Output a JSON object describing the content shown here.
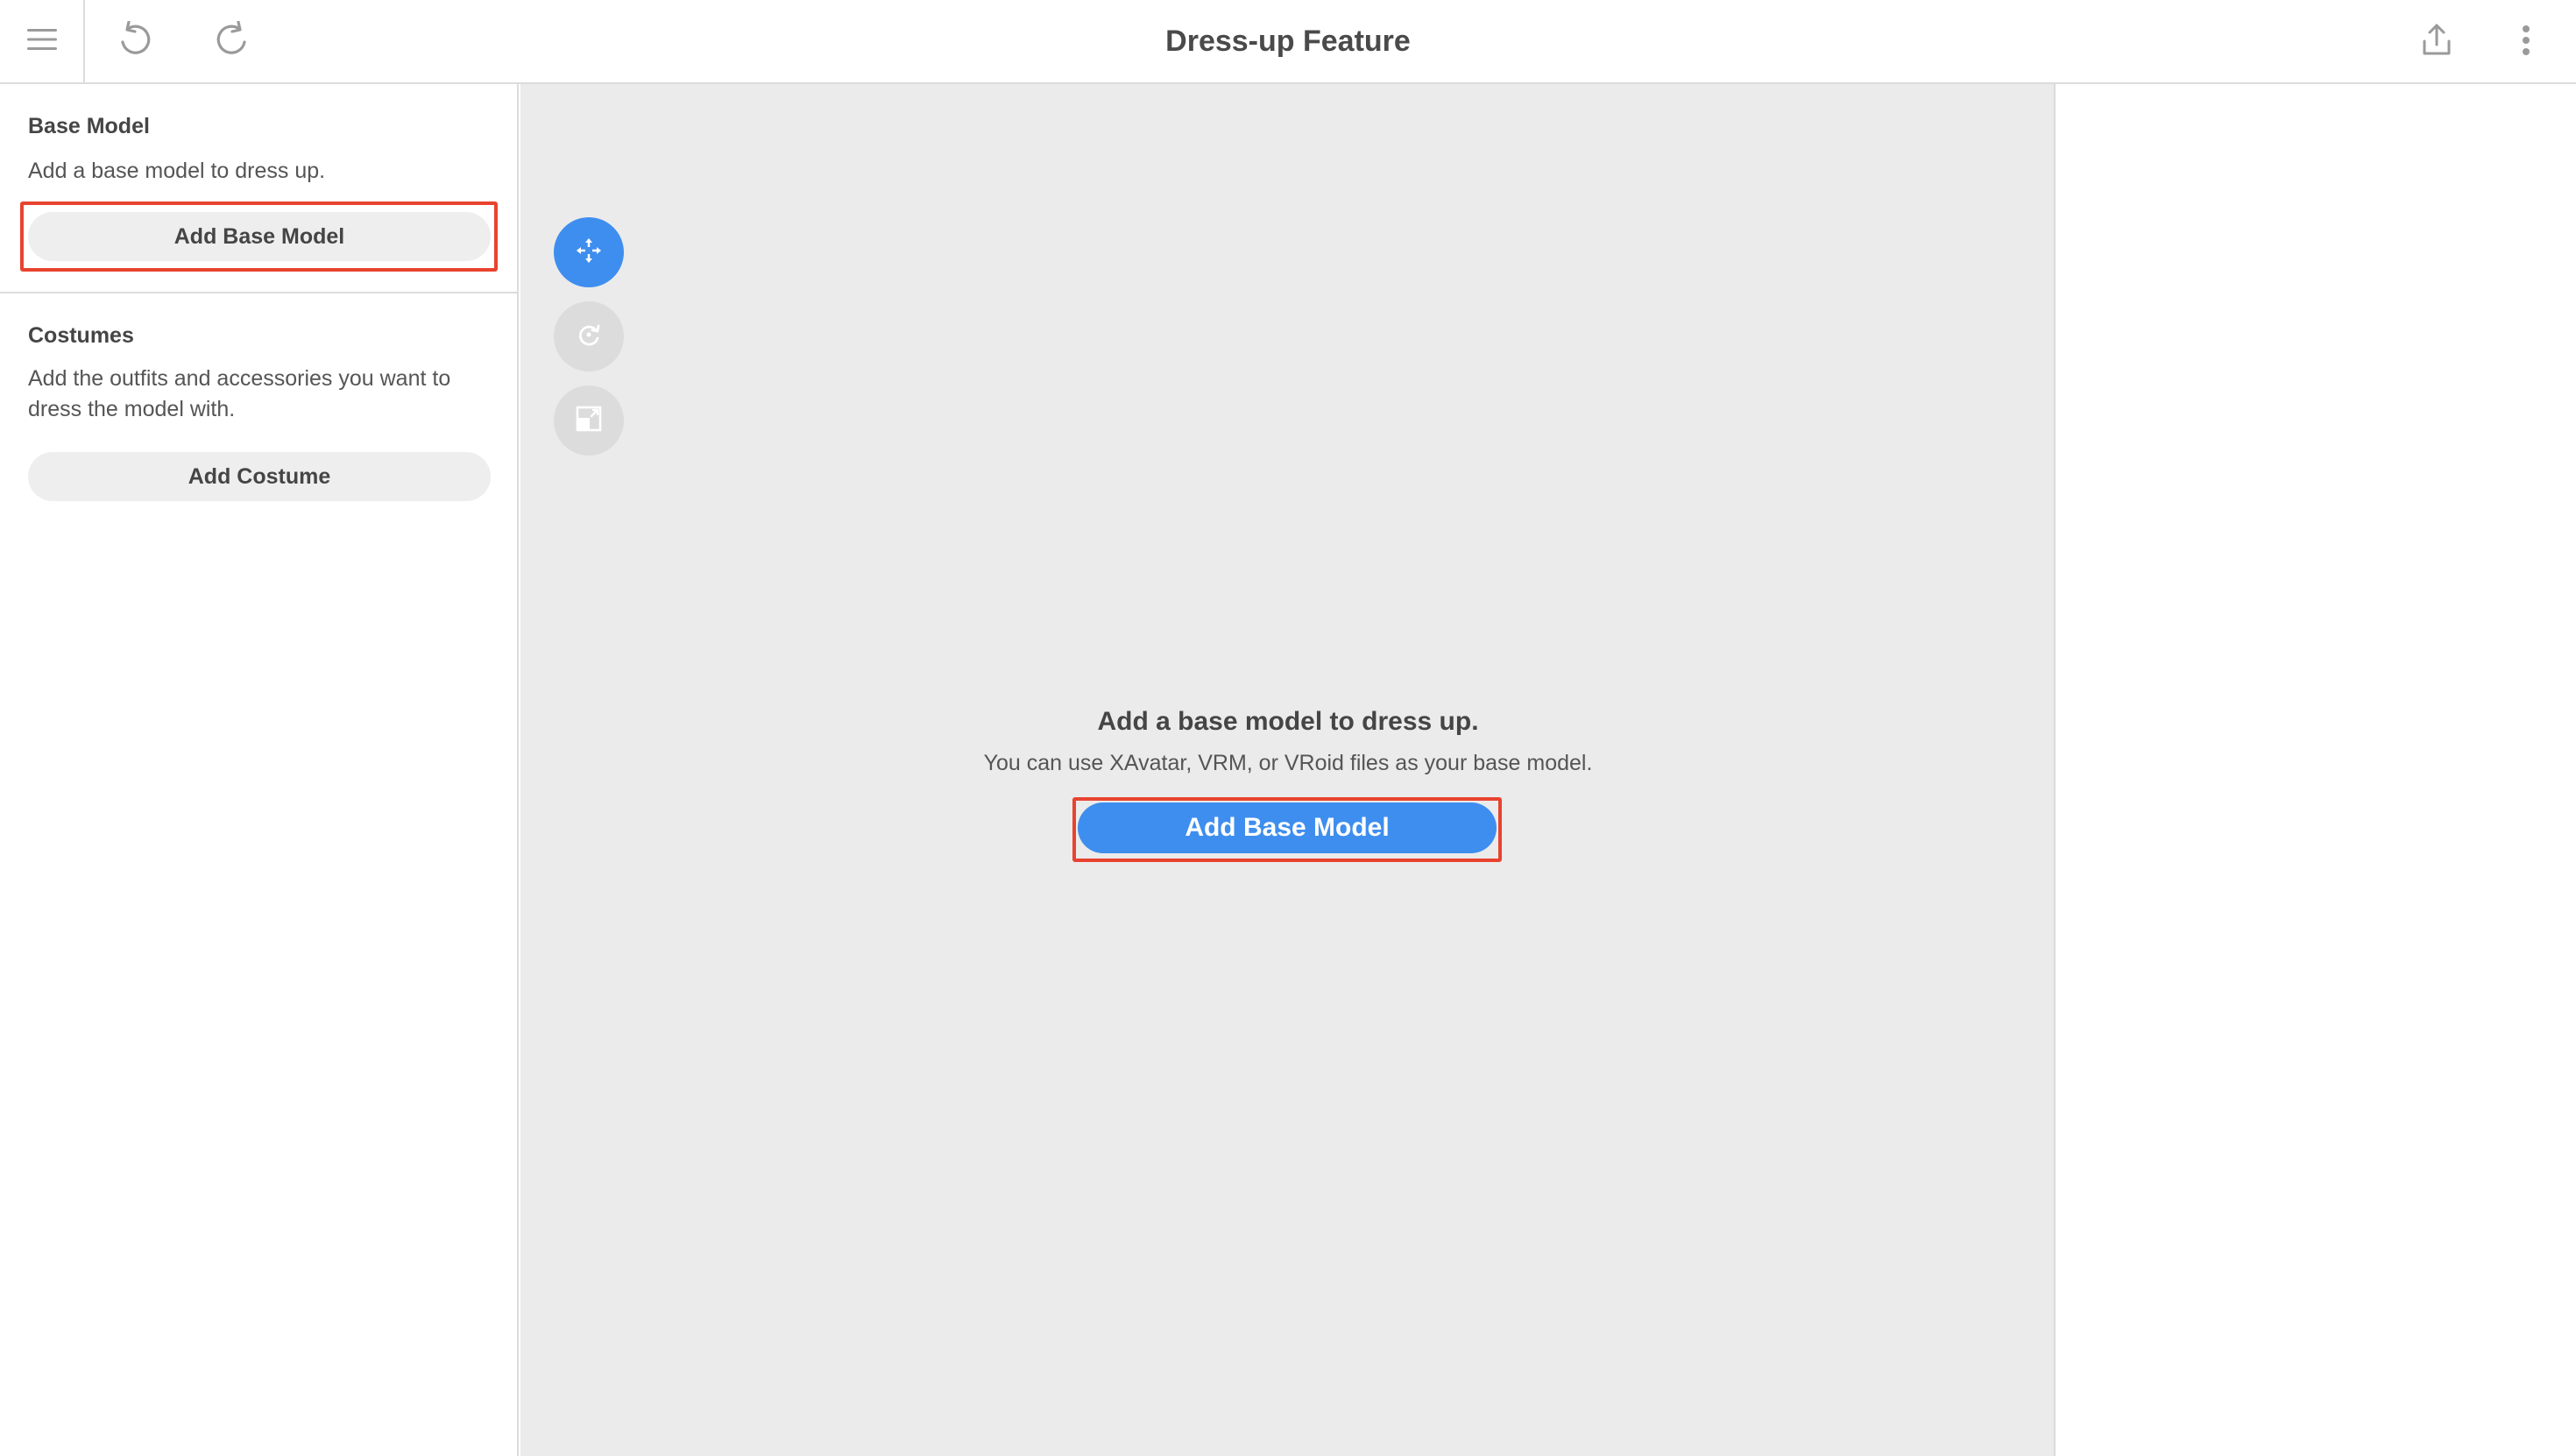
{
  "header": {
    "title": "Dress-up Feature",
    "icons": {
      "menu": "hamburger-menu-icon",
      "undo": "undo-icon",
      "redo": "redo-icon",
      "export": "share-export-icon",
      "more": "more-vertical-icon"
    }
  },
  "sidebar": {
    "base_model": {
      "title": "Base Model",
      "description": "Add a base model to dress up.",
      "button_label": "Add Base Model"
    },
    "costumes": {
      "title": "Costumes",
      "description": "Add the outfits and accessories you want to dress the model with.",
      "button_label": "Add Costume"
    }
  },
  "viewport": {
    "tools": [
      {
        "name": "move-tool",
        "icon": "move-arrows-icon",
        "active": true
      },
      {
        "name": "rotate-tool",
        "icon": "rotate-icon",
        "active": false
      },
      {
        "name": "scale-tool",
        "icon": "scale-icon",
        "active": false
      }
    ],
    "empty_state": {
      "title": "Add a base model to dress up.",
      "subtitle": "You can use XAvatar, VRM, or VRoid files as your base model.",
      "button_label": "Add Base Model"
    }
  },
  "colors": {
    "accent": "#3e8eef",
    "highlight": "#e8432f",
    "viewport_bg": "#ebebeb",
    "border": "#dcdcdc"
  }
}
